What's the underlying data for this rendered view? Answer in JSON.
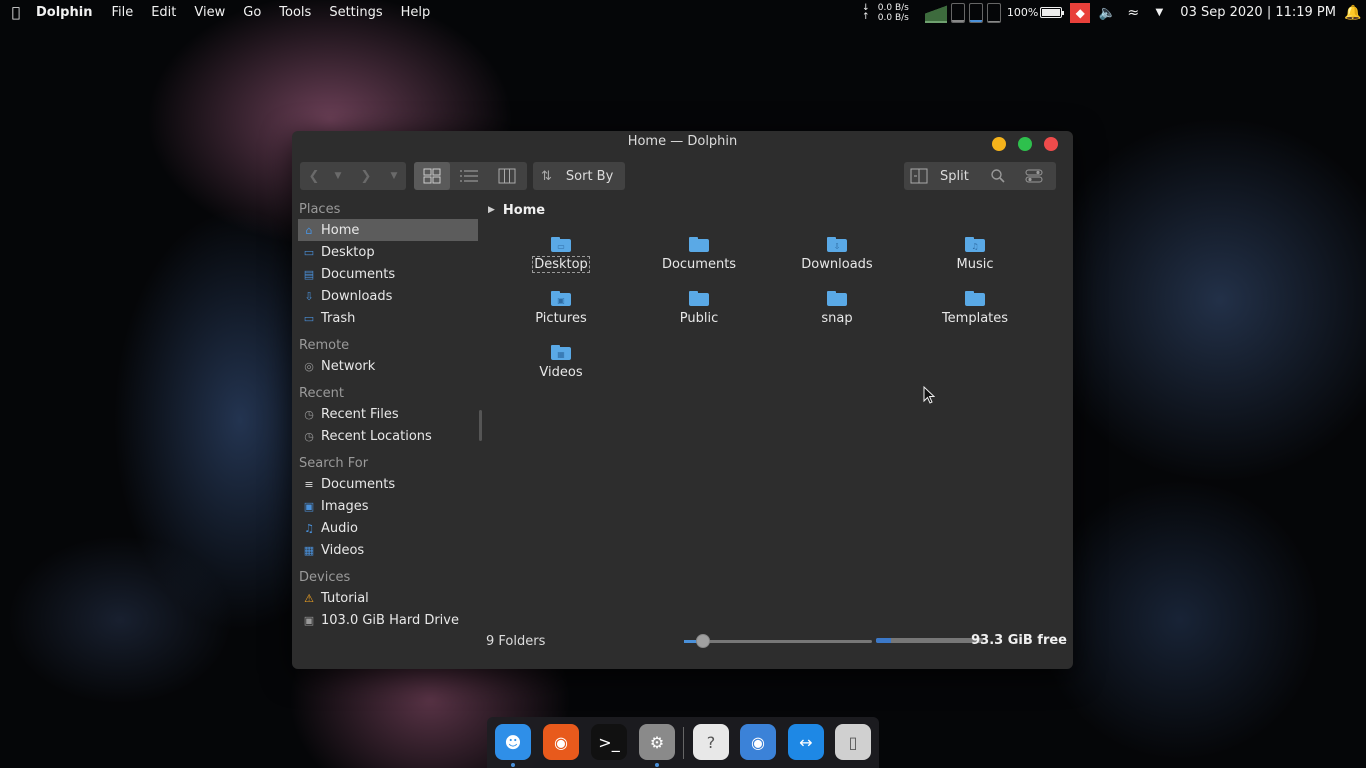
{
  "topbar": {
    "app_name": "Dolphin",
    "menu": [
      "File",
      "Edit",
      "View",
      "Go",
      "Tools",
      "Settings",
      "Help"
    ],
    "net_down": "0.0 B/s",
    "net_up": "0.0 B/s",
    "battery": "100%",
    "battery_level": 1.0,
    "clock": "03 Sep 2020 | 11:19 PM"
  },
  "window": {
    "title": "Home — Dolphin",
    "sort_label": "Sort By",
    "split_label": "Split"
  },
  "sidebar": {
    "sections": [
      {
        "header": "Places",
        "items": [
          {
            "label": "Home",
            "icon": "home-icon",
            "selected": true
          },
          {
            "label": "Desktop",
            "icon": "desktop-icon"
          },
          {
            "label": "Documents",
            "icon": "documents-icon"
          },
          {
            "label": "Downloads",
            "icon": "downloads-icon"
          },
          {
            "label": "Trash",
            "icon": "trash-icon"
          }
        ]
      },
      {
        "header": "Remote",
        "items": [
          {
            "label": "Network",
            "icon": "network-icon"
          }
        ]
      },
      {
        "header": "Recent",
        "items": [
          {
            "label": "Recent Files",
            "icon": "clock-icon"
          },
          {
            "label": "Recent Locations",
            "icon": "clock-icon"
          }
        ]
      },
      {
        "header": "Search For",
        "items": [
          {
            "label": "Documents",
            "icon": "text-lines-icon"
          },
          {
            "label": "Images",
            "icon": "camera-icon"
          },
          {
            "label": "Audio",
            "icon": "music-note-icon"
          },
          {
            "label": "Videos",
            "icon": "film-icon"
          }
        ]
      },
      {
        "header": "Devices",
        "items": [
          {
            "label": "Tutorial",
            "icon": "drive-warning-icon"
          },
          {
            "label": "103.0 GiB Hard Drive",
            "icon": "hard-drive-icon"
          }
        ]
      }
    ]
  },
  "breadcrumb": "Home",
  "files": [
    {
      "name": "Desktop",
      "emblem": "desktop"
    },
    {
      "name": "Documents",
      "emblem": ""
    },
    {
      "name": "Downloads",
      "emblem": "download"
    },
    {
      "name": "Music",
      "emblem": "music"
    },
    {
      "name": "Pictures",
      "emblem": "picture"
    },
    {
      "name": "Public",
      "emblem": ""
    },
    {
      "name": "snap",
      "emblem": ""
    },
    {
      "name": "Templates",
      "emblem": ""
    },
    {
      "name": "Videos",
      "emblem": "video"
    }
  ],
  "status": {
    "count": "9 Folders",
    "zoom_fraction": 0.1,
    "space_used_fraction": 0.14,
    "free": "93.3 GiB free"
  },
  "dock": [
    {
      "name": "finder-icon",
      "color": "#2f8fe8"
    },
    {
      "name": "firefox-icon",
      "color": "#e85a1c"
    },
    {
      "name": "terminal-icon",
      "color": "#111111"
    },
    {
      "name": "settings-icon",
      "color": "#8a8a8a"
    },
    {
      "name": "unknown-file-icon",
      "color": "#e8e8e8"
    },
    {
      "name": "chrome-icon",
      "color": "#3b82d8"
    },
    {
      "name": "anydesk-dock-icon",
      "color": "#1e88e5"
    },
    {
      "name": "trash-bin-icon",
      "color": "#d0d0d0"
    }
  ],
  "colors": {
    "accent": "#4a90d9",
    "folder": "#5aa9e6",
    "close": "#ee4b4b",
    "minimize": "#f5b31b",
    "maximize": "#2ec04d"
  }
}
